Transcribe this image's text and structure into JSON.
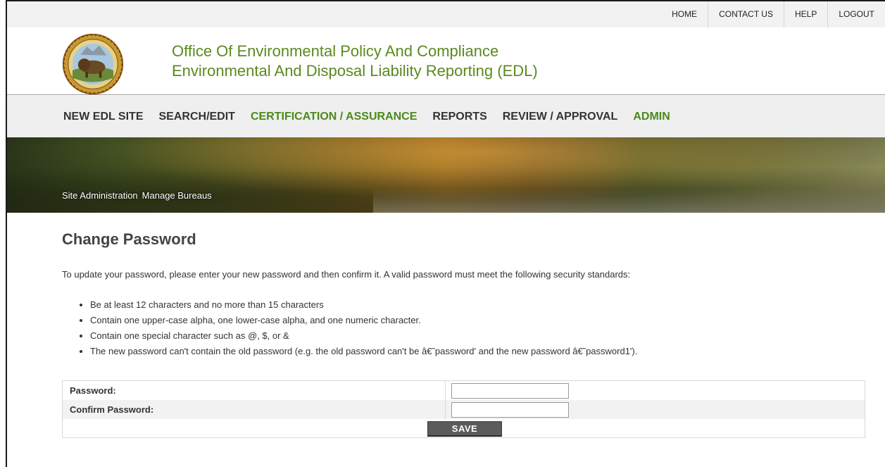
{
  "top_links": [
    "HOME",
    "CONTACT US",
    "HELP",
    "LOGOUT"
  ],
  "header": {
    "title_line1": "Office Of Environmental Policy And Compliance",
    "title_line2": "Environmental And Disposal Liability Reporting (EDL)",
    "seal_icon": "doi-seal-icon"
  },
  "nav": [
    {
      "label": "NEW EDL SITE",
      "active": false
    },
    {
      "label": "SEARCH/EDIT",
      "active": false
    },
    {
      "label": "CERTIFICATION / ASSURANCE",
      "active": true
    },
    {
      "label": "REPORTS",
      "active": false
    },
    {
      "label": "REVIEW / APPROVAL",
      "active": false
    },
    {
      "label": "ADMIN",
      "active": true
    }
  ],
  "breadcrumbs": [
    "Site Administration",
    "Manage Bureaus"
  ],
  "page": {
    "title": "Change Password",
    "intro": "To update your password, please enter your new password and then confirm it.  A valid password must meet the following security standards:",
    "rules": [
      "Be at least 12 characters and no more than 15 characters",
      "Contain one upper-case alpha, one lower-case alpha, and one numeric character.",
      "Contain one special character such as @, $, or &",
      "The new password can't contain the old password (e.g. the old password can't be â€˜password' and the new password â€˜password1')."
    ]
  },
  "form": {
    "password_label": "Password:",
    "password_value": "",
    "confirm_label": "Confirm Password:",
    "confirm_value": "",
    "save_label": "SAVE"
  },
  "colors": {
    "brand_green": "#5a8a1f",
    "nav_green": "#4b8a1a",
    "button_gray": "#5b5b5b"
  }
}
